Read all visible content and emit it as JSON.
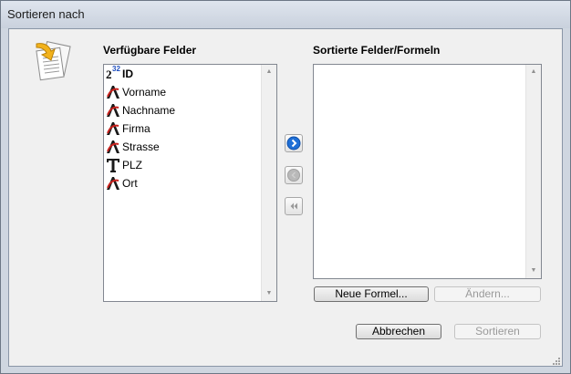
{
  "window": {
    "title": "Sortieren nach"
  },
  "available": {
    "label": "Verfügbare Felder",
    "items": [
      {
        "label": "ID",
        "icon": "number-field-icon",
        "bold": true
      },
      {
        "label": "Vorname",
        "icon": "text-field-icon"
      },
      {
        "label": "Nachname",
        "icon": "text-field-icon"
      },
      {
        "label": "Firma",
        "icon": "text-field-icon"
      },
      {
        "label": "Strasse",
        "icon": "text-field-icon"
      },
      {
        "label": "PLZ",
        "icon": "text-type-icon"
      },
      {
        "label": "Ort",
        "icon": "text-field-icon"
      }
    ],
    "id_exponent": "32",
    "id_base": "2"
  },
  "sorted": {
    "label": "Sortierte Felder/Formeln",
    "items": []
  },
  "buttons": {
    "new_formula": "Neue Formel...",
    "change": "Ändern...",
    "cancel": "Abbrechen",
    "sort": "Sortieren"
  },
  "colors": {
    "accent_blue": "#1f6fd6",
    "text_field_red": "#c8201c"
  }
}
